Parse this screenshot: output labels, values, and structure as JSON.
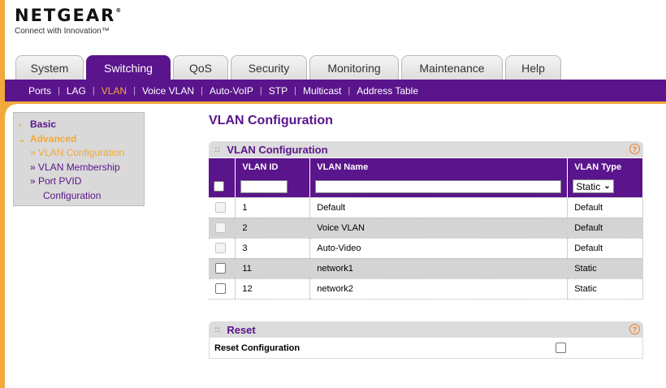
{
  "brand": {
    "name": "NETGEAR",
    "tagline": "Connect with Innovation™"
  },
  "tabs": [
    {
      "label": "System",
      "width": 84
    },
    {
      "label": "Switching",
      "width": 104,
      "active": true
    },
    {
      "label": "QoS",
      "width": 68
    },
    {
      "label": "Security",
      "width": 94
    },
    {
      "label": "Monitoring",
      "width": 110
    },
    {
      "label": "Maintenance",
      "width": 125
    },
    {
      "label": "Help",
      "width": 69
    }
  ],
  "subnav": [
    "Ports",
    "LAG",
    "VLAN",
    "Voice VLAN",
    "Auto-VoIP",
    "STP",
    "Multicast",
    "Address Table"
  ],
  "subnav_active": "VLAN",
  "leftmenu": {
    "basic": "Basic",
    "advanced": "Advanced",
    "items": [
      "» VLAN Configuration",
      "» VLAN Membership",
      "» Port PVID",
      "Configuration"
    ]
  },
  "page_title": "VLAN Configuration",
  "vlan_section": {
    "title": "VLAN Configuration",
    "headers": [
      "VLAN ID",
      "VLAN Name",
      "VLAN Type"
    ],
    "input": {
      "vlan_id": "",
      "vlan_name": "",
      "type": "Static"
    },
    "rows": [
      {
        "id": "1",
        "name": "Default",
        "type": "Default"
      },
      {
        "id": "2",
        "name": "Voice VLAN",
        "type": "Default"
      },
      {
        "id": "3",
        "name": "Auto-Video",
        "type": "Default"
      },
      {
        "id": "11",
        "name": "network1",
        "type": "Static"
      },
      {
        "id": "12",
        "name": "network2",
        "type": "Static"
      }
    ]
  },
  "reset_section": {
    "title": "Reset",
    "label": "Reset Configuration"
  },
  "help_glyph": "?",
  "colors": {
    "purple": "#5a148c",
    "orange": "#f2a93b"
  }
}
